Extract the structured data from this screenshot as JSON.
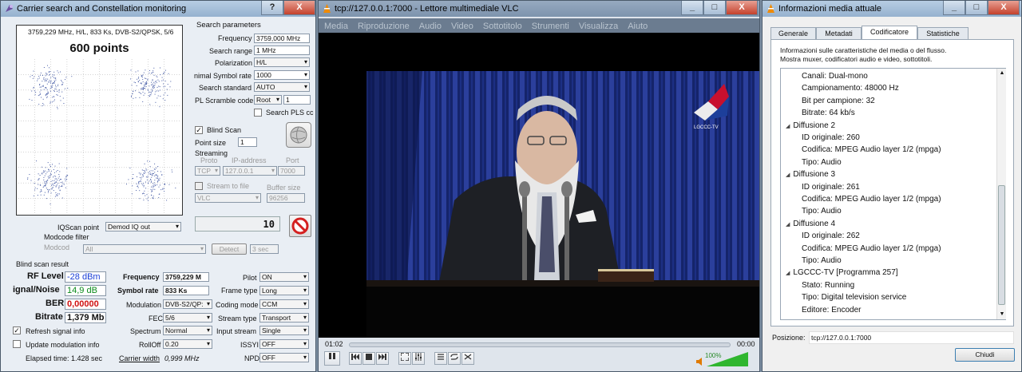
{
  "left": {
    "title": "Carrier search and Constellation monitoring",
    "help_label": "?",
    "close_label": "X",
    "constellation": {
      "info": "3759,229 MHz, H/L, 833 Ks, DVB-S2/QPSK, 5/6",
      "points_label": "600 points"
    },
    "search_params": {
      "header": "Search parameters",
      "frequency_label": "Frequency",
      "frequency_value": "3759,000 MHz",
      "range_label": "Search range",
      "range_value": "1 MHz",
      "polarization_label": "Polarization",
      "polarization_value": "H/L",
      "min_sr_label": "nimal Symbol rate",
      "min_sr_value": "1000",
      "standard_label": "Search standard",
      "standard_value": "AUTO",
      "scramble_label": "PL Scramble code",
      "scramble_mode": "Root",
      "scramble_value": "1",
      "pls_label": "Search PLS cc",
      "blind_label": "Blind Scan",
      "point_size_label": "Point size",
      "point_size_value": "1",
      "streaming_label": "Streaming",
      "proto_label": "Proto",
      "ip_label": "IP-address",
      "port_label": "Port",
      "proto_value": "TCP",
      "ip_value": "127.0.0.1",
      "port_value": "7000",
      "stream_file_label": "Stream to file",
      "buffer_label": "Buffer size",
      "player_value": "VLC",
      "buffer_value": "96256",
      "counter_value": "10"
    },
    "iqscan": {
      "label": "IQScan point",
      "value": "Demod IQ out"
    },
    "modcode": {
      "filter_label": "Modcode filter",
      "label": "Modcod",
      "value": "All",
      "detect_label": "Detect",
      "sec_value": "3 sec"
    },
    "result": {
      "header": "Blind scan result",
      "rf_label": "RF Level",
      "rf_value": "-28 dBm",
      "snr_label": "ignal/Noise",
      "snr_value": "14,9 dB",
      "ber_label": "BER",
      "ber_value": "0,00000",
      "bitrate_label": "Bitrate",
      "bitrate_value": "1,379 Mb",
      "freq_label": "Frequency",
      "freq_value": "3759,229 M",
      "sr_label": "Symbol rate",
      "sr_value": "833 Ks",
      "mod_label": "Modulation",
      "mod_value": "DVB-S2/QP:",
      "fec_label": "FEC",
      "fec_value": "5/6",
      "spectrum_label": "Spectrum",
      "spectrum_value": "Normal",
      "rolloff_label": "RollOff",
      "rolloff_value": "0.20",
      "cw_label": "Carrier width",
      "cw_value": "0,999 MHz",
      "pilot_label": "Pilot",
      "pilot_value": "ON",
      "frame_label": "Frame type",
      "frame_value": "Long",
      "coding_label": "Coding mode",
      "coding_value": "CCM",
      "stream_type_label": "Stream type",
      "stream_type_value": "Transport",
      "input_stream_label": "Input stream",
      "input_stream_value": "Single",
      "issyi_label": "ISSYI",
      "issyi_value": "OFF",
      "npd_label": "NPD",
      "npd_value": "OFF",
      "refresh_label": "Refresh signal info",
      "update_label": "Update modulation info",
      "elapsed_label": "Elapsed time: 1.428 sec"
    }
  },
  "vlc": {
    "title": "tcp://127.0.0.1:7000 - Lettore multimediale VLC",
    "menu": [
      "Media",
      "Riproduzione",
      "Audio",
      "Video",
      "Sottotitolo",
      "Strumenti",
      "Visualizza",
      "Aiuto"
    ],
    "logo_text": "LGCCC-TV",
    "time_elapsed": "01:02",
    "time_total": "00:00",
    "volume": "100%",
    "min_label": "_",
    "max_label": "□",
    "close_label": "X"
  },
  "info": {
    "title": "Informazioni media attuale",
    "tabs": [
      "Generale",
      "Metadati",
      "Codificatore",
      "Statistiche"
    ],
    "description": "Informazioni sulle caratteristiche del media o del flusso.",
    "description2": "Mostra muxer, codificatori audio e video, sottotitoli.",
    "tree": [
      {
        "t": "Canali: Dual-mono",
        "lvl": 2
      },
      {
        "t": "Campionamento: 48000 Hz",
        "lvl": 2
      },
      {
        "t": "Bit per campione: 32",
        "lvl": 2
      },
      {
        "t": "Bitrate: 64 kb/s",
        "lvl": 2
      },
      {
        "t": "Diffusione 2",
        "lvl": 1
      },
      {
        "t": "ID originale: 260",
        "lvl": 2
      },
      {
        "t": "Codifica: MPEG Audio layer 1/2 (mpga)",
        "lvl": 2
      },
      {
        "t": "Tipo: Audio",
        "lvl": 2
      },
      {
        "t": "Diffusione 3",
        "lvl": 1
      },
      {
        "t": "ID originale: 261",
        "lvl": 2
      },
      {
        "t": "Codifica: MPEG Audio layer 1/2 (mpga)",
        "lvl": 2
      },
      {
        "t": "Tipo: Audio",
        "lvl": 2
      },
      {
        "t": "Diffusione 4",
        "lvl": 1
      },
      {
        "t": "ID originale: 262",
        "lvl": 2
      },
      {
        "t": "Codifica: MPEG Audio layer 1/2 (mpga)",
        "lvl": 2
      },
      {
        "t": "Tipo: Audio",
        "lvl": 2
      },
      {
        "t": "LGCCC-TV [Programma 257]",
        "lvl": 1
      },
      {
        "t": "Stato: Running",
        "lvl": 2
      },
      {
        "t": "Tipo: Digital television service",
        "lvl": 2
      },
      {
        "t": "Editore: Encoder",
        "lvl": 2
      }
    ],
    "position_label": "Posizione:",
    "position_value": "tcp://127.0.0.1:7000",
    "close_button": "Chiudi"
  },
  "colors": {
    "rf_value": "#1a3fd6",
    "snr_value": "#0a8a1a",
    "ber_value": "#d01010"
  }
}
